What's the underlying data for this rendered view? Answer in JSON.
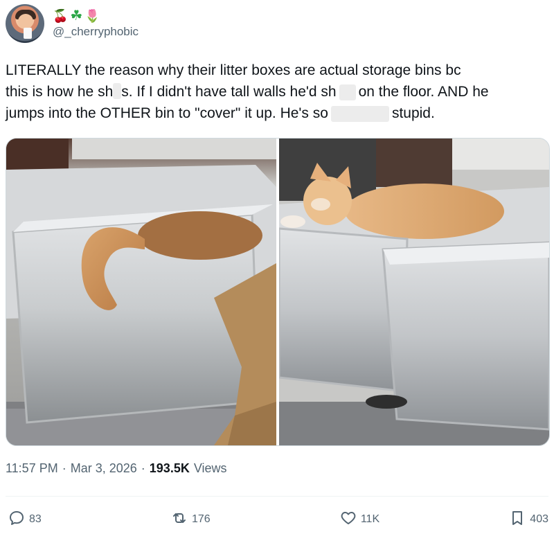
{
  "author": {
    "emojis": [
      "🍒",
      "☘",
      "🌷"
    ],
    "handle": "@_cherryphobic"
  },
  "tweet": {
    "line1": "LITERALLY the reason why their litter boxes are actual storage bins bc",
    "line2a": "this is how he sh",
    "line2b": "s. If I didn't have tall walls he'd sh",
    "line2c": "on the floor. AND he",
    "line3a": "jumps into the OTHER bin to \"cover\" it up. He's so",
    "line3b": "stupid."
  },
  "meta": {
    "time": "11:57 PM",
    "sep1": "·",
    "date": "Mar 3, 2026",
    "sep2": "·",
    "views_count": "193.5K",
    "views_label": "Views"
  },
  "actions": {
    "replies": "83",
    "reposts": "176",
    "likes": "11K",
    "bookmarks": "403"
  },
  "colors": {
    "text": "#0f1419",
    "secondary": "#536471",
    "border": "#cfd9de"
  }
}
